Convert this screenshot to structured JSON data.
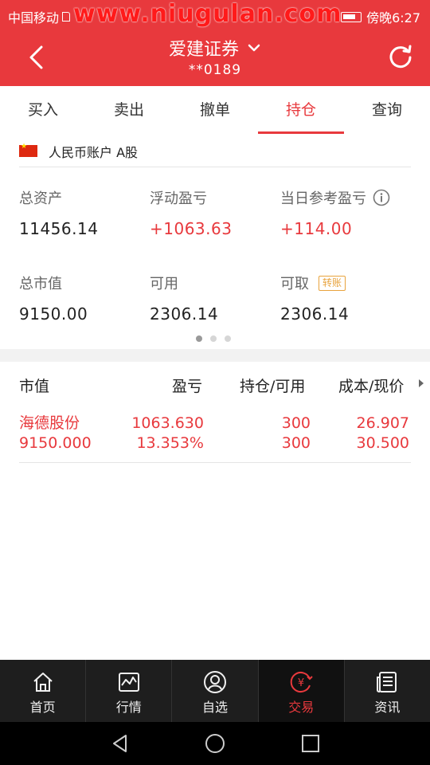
{
  "status_bar": {
    "carrier": "中国移动",
    "time": "傍晚6:27",
    "watermark": "www.niugulan.com"
  },
  "header": {
    "title": "爱建证券",
    "account": "**0189"
  },
  "tabs": [
    {
      "label": "买入",
      "active": false
    },
    {
      "label": "卖出",
      "active": false
    },
    {
      "label": "撤单",
      "active": false
    },
    {
      "label": "持仓",
      "active": true
    },
    {
      "label": "查询",
      "active": false
    }
  ],
  "account_type": "人民币账户 A股",
  "summary": {
    "total_assets_label": "总资产",
    "total_assets": "11456.14",
    "float_pnl_label": "浮动盈亏",
    "float_pnl": "+1063.63",
    "daily_pnl_label": "当日参考盈亏",
    "daily_pnl": "+114.00",
    "market_value_label": "总市值",
    "market_value": "9150.00",
    "available_label": "可用",
    "available": "2306.14",
    "withdrawable_label": "可取",
    "withdrawable": "2306.14",
    "transfer_badge": "转账"
  },
  "holdings": {
    "columns": [
      "市值",
      "盈亏",
      "持仓/可用",
      "成本/现价"
    ],
    "rows": [
      {
        "name": "海德股份",
        "market_value": "9150.000",
        "pnl": "1063.630",
        "pnl_pct": "13.353%",
        "position": "300",
        "available": "300",
        "cost": "26.907",
        "price": "30.500"
      }
    ]
  },
  "bottom_nav": [
    {
      "label": "首页",
      "icon": "home-icon",
      "active": false
    },
    {
      "label": "行情",
      "icon": "chart-icon",
      "active": false
    },
    {
      "label": "自选",
      "icon": "user-icon",
      "active": false
    },
    {
      "label": "交易",
      "icon": "yuan-icon",
      "active": true
    },
    {
      "label": "资讯",
      "icon": "news-icon",
      "active": false
    }
  ],
  "colors": {
    "brand": "#e8393d",
    "badge": "#e8a33d"
  }
}
